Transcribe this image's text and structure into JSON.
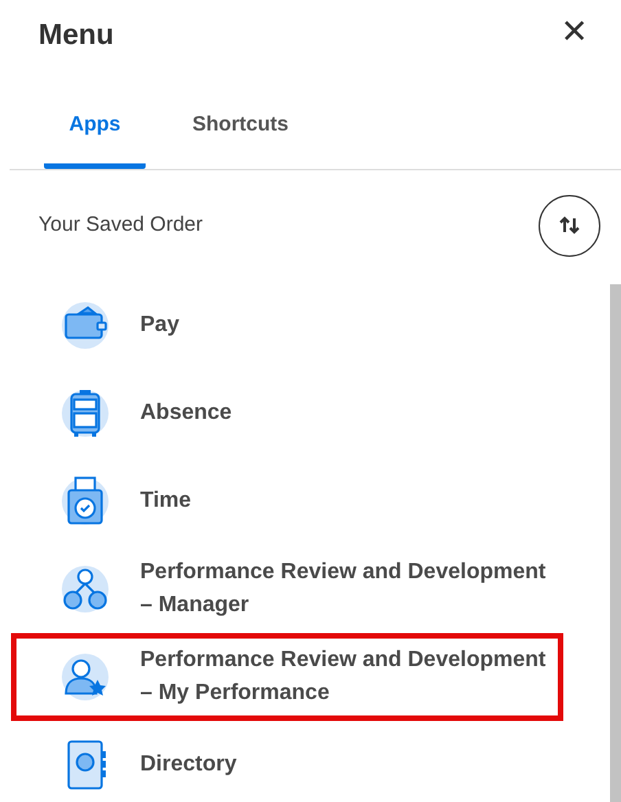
{
  "title": "Menu",
  "close": "✕",
  "tabs": [
    {
      "label": "Apps",
      "selected": true
    },
    {
      "label": "Shortcuts",
      "selected": false
    }
  ],
  "section": {
    "label": "Your Saved Order"
  },
  "apps": [
    {
      "label": "Pay",
      "kind": "wallet",
      "highlighted": false
    },
    {
      "label": "Absence",
      "kind": "suitcase",
      "highlighted": false
    },
    {
      "label": "Time",
      "kind": "timeclock",
      "highlighted": false
    },
    {
      "label": "Performance Review and Development – Manager",
      "kind": "team",
      "highlighted": false
    },
    {
      "label": "Performance Review and Development – My Performance",
      "kind": "person-star",
      "highlighted": true
    },
    {
      "label": "Directory",
      "kind": "book",
      "highlighted": false
    }
  ]
}
